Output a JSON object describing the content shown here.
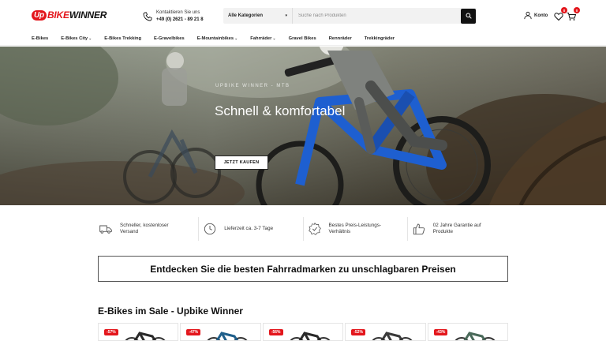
{
  "logo": {
    "badge": "Up",
    "bike": "BIKE",
    "winner": "WINNER"
  },
  "contact": {
    "label": "Kontaktieren Sie uns",
    "phone": "+49 (0) 2621 - 89 21 8"
  },
  "search": {
    "category": "Alle Kategorien",
    "placeholder": "Suche nach Produkten"
  },
  "account": {
    "label": "Konto"
  },
  "wishlist": {
    "count": "0"
  },
  "cart": {
    "count": "0"
  },
  "nav": [
    {
      "label": "E-Bikes",
      "chevron": false
    },
    {
      "label": "E-Bikes City",
      "chevron": true
    },
    {
      "label": "E-Bikes Trekking",
      "chevron": false
    },
    {
      "label": "E-Gravelbikes",
      "chevron": false
    },
    {
      "label": "E-Mountainbikes",
      "chevron": true
    },
    {
      "label": "Fahrräder",
      "chevron": true
    },
    {
      "label": "Gravel Bikes",
      "chevron": false
    },
    {
      "label": "Rennräder",
      "chevron": false
    },
    {
      "label": "Trekkingräder",
      "chevron": false
    }
  ],
  "hero": {
    "eyebrow": "UPBIKE WINNER - MTB",
    "title": "Schnell & komfortabel",
    "button": "JETZT KAUFEN"
  },
  "features": [
    {
      "icon": "truck-icon",
      "line1": "Schneller, kostenloser",
      "line2": "Versand"
    },
    {
      "icon": "clock-icon",
      "line1": "Lieferzeit ca. 3-7 Tage",
      "line2": ""
    },
    {
      "icon": "badge-icon",
      "line1": "Bestes Preis-Leistungs-",
      "line2": "Verhältnis"
    },
    {
      "icon": "thumbs-up-icon",
      "line1": "02 Jahre Garantie auf",
      "line2": "Produkte"
    }
  ],
  "banner": {
    "text": "Entdecken Sie die besten Fahrradmarken zu unschlagbaren Preisen"
  },
  "section": {
    "title": "E-Bikes im Sale - Upbike Winner"
  },
  "products": [
    {
      "discount": "-57%",
      "frame_color": "#2a2a2a"
    },
    {
      "discount": "-47%",
      "frame_color": "#1f5f8b"
    },
    {
      "discount": "-56%",
      "frame_color": "#2a2a2a"
    },
    {
      "discount": "-52%",
      "frame_color": "#3a3a3a"
    },
    {
      "discount": "-43%",
      "frame_color": "#4a6a5a"
    }
  ],
  "colors": {
    "accent": "#e3161c",
    "dark": "#111111"
  }
}
